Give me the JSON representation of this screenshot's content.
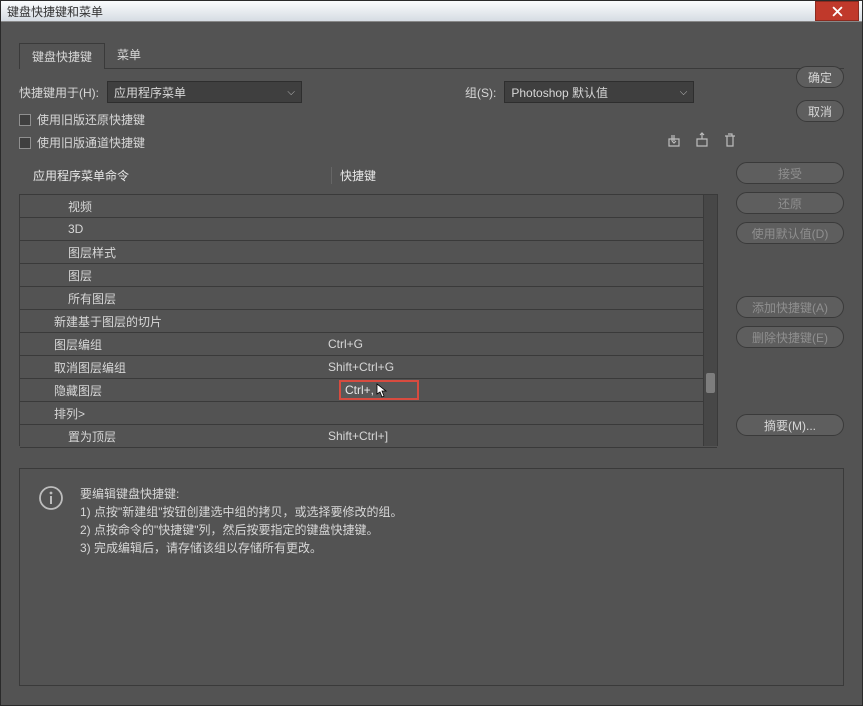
{
  "window": {
    "title": "键盘快捷键和菜单"
  },
  "tabs": {
    "t1": "键盘快捷键",
    "t2": "菜单"
  },
  "controls": {
    "shortcutsFor": "快捷键用于(H):",
    "shortcutsForValue": "应用程序菜单",
    "groupLabel": "组(S):",
    "groupValue": "Photoshop 默认值",
    "useOldRestore": "使用旧版还原快捷键",
    "useOldChannel": "使用旧版通道快捷键"
  },
  "header": {
    "cmd": "应用程序菜单命令",
    "shortcut": "快捷键"
  },
  "rows": [
    {
      "label": "视频",
      "short": "",
      "indent": "pad2"
    },
    {
      "label": "3D",
      "short": "",
      "indent": "pad2"
    },
    {
      "label": "图层样式",
      "short": "",
      "indent": "pad2"
    },
    {
      "label": "图层",
      "short": "",
      "indent": "pad2"
    },
    {
      "label": "所有图层",
      "short": "",
      "indent": "pad2"
    },
    {
      "label": "新建基于图层的切片",
      "short": "",
      "indent": "pad1"
    },
    {
      "label": "图层编组",
      "short": "Ctrl+G",
      "indent": "pad1"
    },
    {
      "label": "取消图层编组",
      "short": "Shift+Ctrl+G",
      "indent": "pad1"
    },
    {
      "label": "隐藏图层",
      "short": "Ctrl+,",
      "indent": "pad1",
      "editing": true
    },
    {
      "label": "排列>",
      "short": "",
      "indent": "pad1"
    },
    {
      "label": "置为顶层",
      "short": "Shift+Ctrl+]",
      "indent": "pad2"
    }
  ],
  "side": {
    "accept": "接受",
    "undo": "还原",
    "useDefault": "使用默认值(D)",
    "addShortcut": "添加快捷键(A)",
    "delShortcut": "删除快捷键(E)",
    "summary": "摘要(M)..."
  },
  "main": {
    "ok": "确定",
    "cancel": "取消"
  },
  "info": {
    "title": "要编辑键盘快捷键:",
    "l1": "1) 点按\"新建组\"按钮创建选中组的拷贝，或选择要修改的组。",
    "l2": "2) 点按命令的\"快捷键\"列，然后按要指定的键盘快捷键。",
    "l3": "3) 完成编辑后，请存储该组以存储所有更改。"
  },
  "editValue": "Ctrl+,"
}
